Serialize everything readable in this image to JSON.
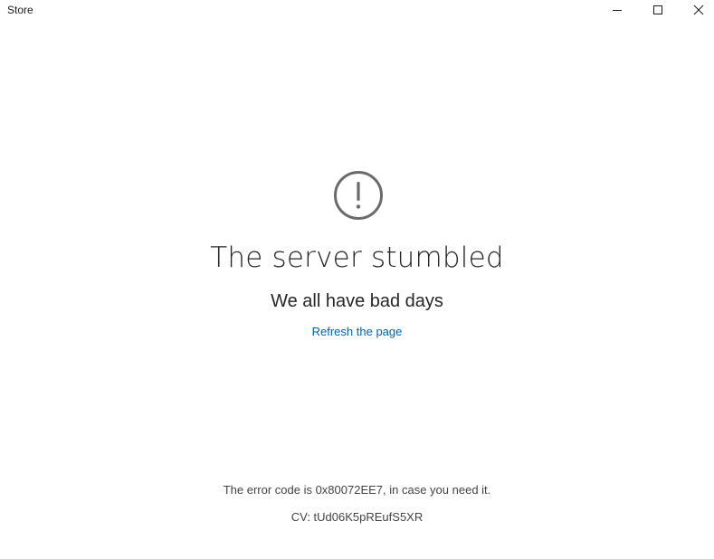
{
  "window": {
    "title": "Store"
  },
  "caption_buttons": {
    "minimize": "minimize-icon",
    "maximize": "maximize-icon",
    "close": "close-icon"
  },
  "error": {
    "icon": "exclamation-circle-icon",
    "headline": "The server stumbled",
    "subhead": "We all have bad days",
    "refresh_label": "Refresh the page",
    "code_text": "The error code is 0x80072EE7, in case you need it.",
    "cv_text": "CV: tUd06K5pREufS5XR"
  },
  "colors": {
    "link": "#0063b1",
    "icon": "#6b6b6b",
    "text": "#262626"
  }
}
